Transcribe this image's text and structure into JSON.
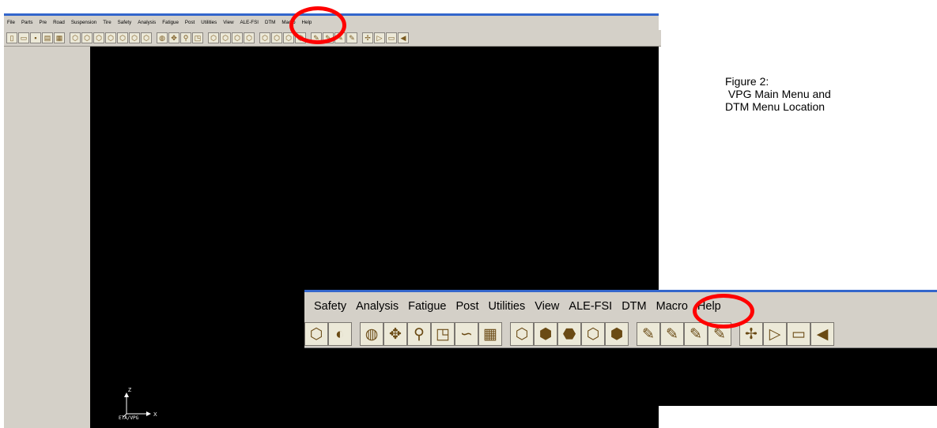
{
  "main_menu": [
    "File",
    "Parts",
    "Pre",
    "Road",
    "Suspension",
    "Tire",
    "Safety",
    "Analysis",
    "Fatigue",
    "Post",
    "Utilities",
    "View",
    "ALE-FSI",
    "DTM",
    "Macro",
    "Help"
  ],
  "main_toolbar_icons": [
    "new-file-icon",
    "open-folder-icon",
    "save-icon",
    "print-icon",
    "image-icon",
    "cube-icon",
    "cube-icon",
    "cube-icon",
    "cube-icon",
    "cube-icon",
    "cube-icon",
    "cube-icon",
    "sphere-icon",
    "pan-icon",
    "zoom-icon",
    "window-zoom-icon",
    "cube-icon",
    "cube-icon",
    "cube-icon",
    "cube-icon",
    "cube-icon",
    "cube-icon",
    "cube-icon",
    "cube-icon",
    "pen-icon",
    "pen-icon",
    "pen-icon",
    "pen-icon",
    "axis-icon",
    "triangle-icon",
    "ruler-icon",
    "arrow-icon"
  ],
  "viewport": {
    "axis_z": "Z",
    "axis_x": "X",
    "product_label": "ETA/VPG"
  },
  "caption": {
    "line1": "Figure 2:",
    "line2": " VPG Main Menu and",
    "line3": "DTM Menu Location"
  },
  "inset_menu": [
    "Safety",
    "Analysis",
    "Fatigue",
    "Post",
    "Utilities",
    "View",
    "ALE-FSI",
    "DTM",
    "Macro",
    "Help"
  ],
  "inset_toolbar_icons": [
    "cube-icon",
    "sphere-cube-icon",
    "sphere-icon",
    "pan-icon",
    "zoom-icon",
    "window-zoom-icon",
    "lasso-icon",
    "grid-icon",
    "cube-icon",
    "cube-front-icon",
    "cube-side-icon",
    "cube-top-icon",
    "cube-iso-icon",
    "pen-icon",
    "pen-icon",
    "pen-icon",
    "pen-icon",
    "axis-icon",
    "triangle-icon",
    "ruler-icon",
    "arrow-icon"
  ],
  "highlight_color": "#ff0000",
  "title_bar_color": "#3366cc"
}
